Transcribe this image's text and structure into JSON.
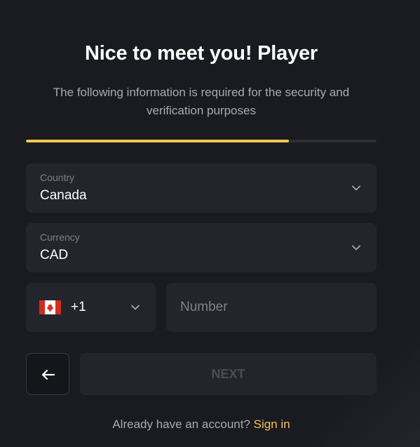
{
  "header": {
    "title": "Nice to meet you! Player",
    "subtitle": "The following information is required for the security and verification purposes"
  },
  "progress": {
    "value": 0.75,
    "fill_color": "#f5c451"
  },
  "form": {
    "country": {
      "label": "Country",
      "value": "Canada"
    },
    "currency": {
      "label": "Currency",
      "value": "CAD"
    },
    "phone": {
      "flag_icon": "canada-flag-icon",
      "dial_code": "+1",
      "number_placeholder": "Number",
      "number_value": ""
    }
  },
  "actions": {
    "back_icon": "arrow-left-icon",
    "next_label": "NEXT"
  },
  "footer": {
    "prompt": "Already have an account?",
    "signin_label": "Sign in"
  },
  "colors": {
    "accent": "#f5c451",
    "background": "#1a1b20",
    "field_background": "#24252c",
    "muted_text": "#a9aab0"
  }
}
